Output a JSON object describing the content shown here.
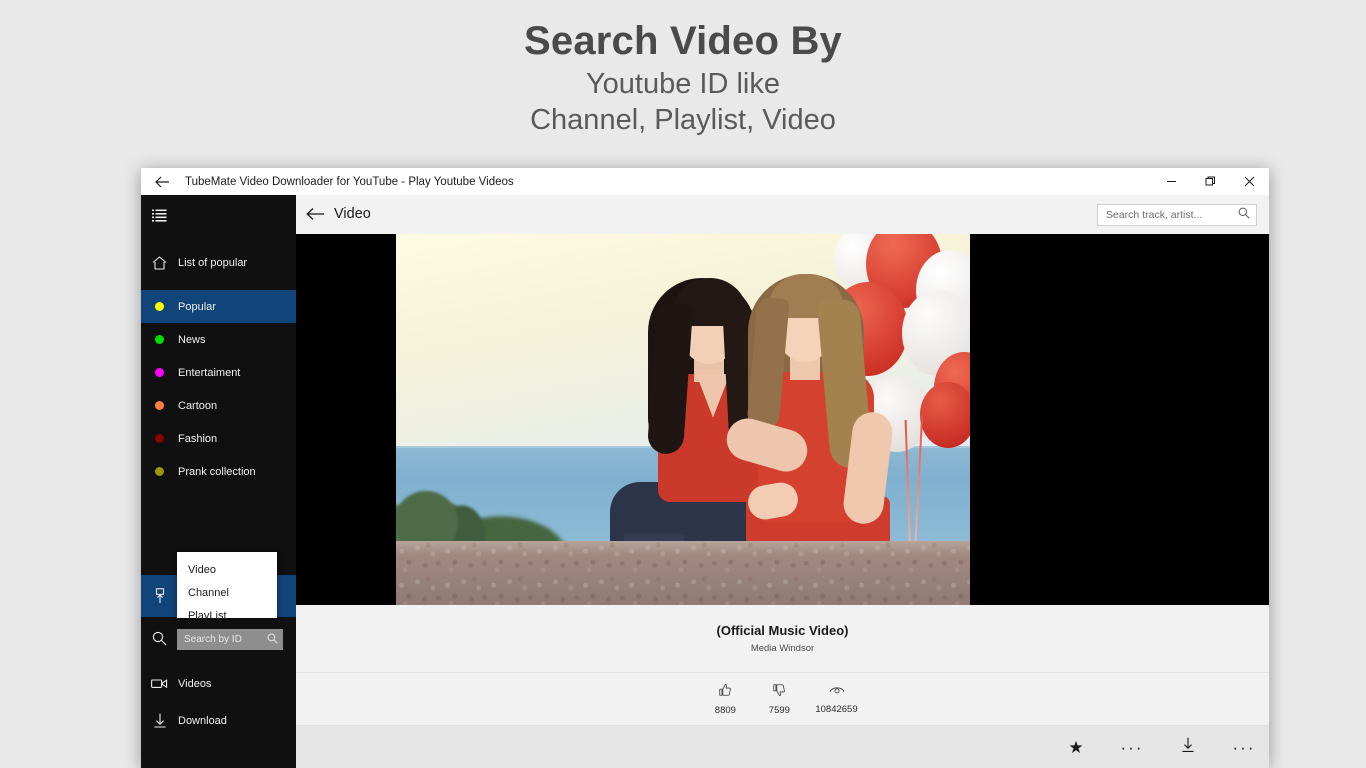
{
  "promo": {
    "title": "Search Video By",
    "subtitle_line1": "Youtube ID like",
    "subtitle_line2": "Channel, Playlist, Video"
  },
  "titlebar": {
    "back_icon": "back-arrow-icon",
    "title": "TubeMate Video Downloader for YouTube - Play Youtube Videos",
    "minimize_label": "Minimize",
    "restore_label": "Restore",
    "close_label": "Close"
  },
  "sidebar": {
    "menu_icon": "hamburger-icon",
    "home": {
      "label": "List of popular",
      "icon": "home-icon"
    },
    "categories": [
      {
        "label": "Popular",
        "color": "#ffff00",
        "selected": true
      },
      {
        "label": "News",
        "color": "#00dd00",
        "selected": false
      },
      {
        "label": "Entertaiment",
        "color": "#ff00ff",
        "selected": false
      },
      {
        "label": "Cartoon",
        "color": "#ff8040",
        "selected": false
      },
      {
        "label": "Fashion",
        "color": "#8b0000",
        "selected": false
      },
      {
        "label": "Prank collection",
        "color": "#999900",
        "selected": false
      }
    ],
    "pin_item": {
      "icon": "pin-upload-icon",
      "selected": true
    },
    "search_item": {
      "icon": "search-icon"
    },
    "bottom_items": [
      {
        "label": "Videos",
        "icon": "video-camera-icon"
      },
      {
        "label": "Download",
        "icon": "download-arrow-icon"
      }
    ],
    "id_search": {
      "placeholder": "Search by ID",
      "icon": "search-icon",
      "options": [
        "Video",
        "Channel",
        "PlayList"
      ]
    }
  },
  "content": {
    "back_icon": "back-arrow-icon",
    "title": "Video",
    "search": {
      "placeholder": "Search track, artist...",
      "icon": "search-icon"
    }
  },
  "video": {
    "title": "(Official Music Video)",
    "artist": "Media Windsor",
    "stats": [
      {
        "name": "likes",
        "icon": "thumbs-up-icon",
        "value": "8809"
      },
      {
        "name": "dislikes",
        "icon": "thumbs-down-icon",
        "value": "7599"
      },
      {
        "name": "views",
        "icon": "eye-icon",
        "value": "10842659"
      }
    ],
    "actions": [
      {
        "name": "favorite",
        "icon": "star-icon",
        "label": "★"
      },
      {
        "name": "more",
        "icon": "ellipsis-icon",
        "label": "···"
      },
      {
        "name": "download",
        "icon": "download-arrow-icon",
        "label": ""
      },
      {
        "name": "overflow",
        "icon": "ellipsis-icon",
        "label": "···"
      }
    ]
  }
}
